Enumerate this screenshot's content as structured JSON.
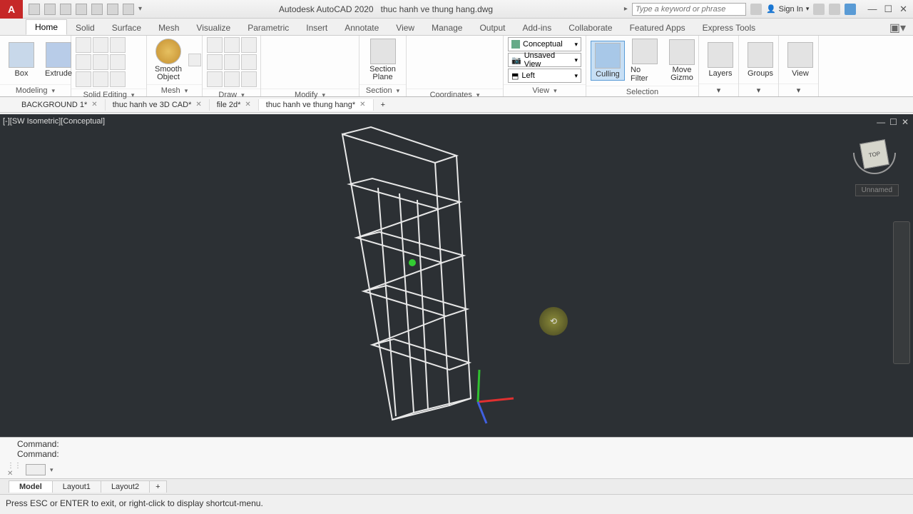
{
  "title": {
    "app": "Autodesk AutoCAD 2020",
    "file": "thuc hanh ve thung hang.dwg"
  },
  "search": {
    "placeholder": "Type a keyword or phrase"
  },
  "signin": {
    "label": "Sign In"
  },
  "ribbon_tabs": [
    "Home",
    "Solid",
    "Surface",
    "Mesh",
    "Visualize",
    "Parametric",
    "Insert",
    "Annotate",
    "View",
    "Manage",
    "Output",
    "Add-ins",
    "Collaborate",
    "Featured Apps",
    "Express Tools"
  ],
  "active_ribbon_tab": "Home",
  "panels": {
    "modeling": {
      "title": "Modeling",
      "box": "Box",
      "extrude": "Extrude"
    },
    "solidediting": {
      "title": "Solid Editing"
    },
    "mesh": {
      "title": "Mesh",
      "smooth": "Smooth Object"
    },
    "draw": {
      "title": "Draw"
    },
    "modify": {
      "title": "Modify"
    },
    "section": {
      "title": "Section",
      "plane": "Section Plane"
    },
    "coordinates": {
      "title": "Coordinates"
    },
    "view": {
      "title": "View",
      "style": "Conceptual",
      "savedview": "Unsaved View",
      "ucs": "Left"
    },
    "selection": {
      "title": "Selection",
      "culling": "Culling",
      "nofilter": "No Filter",
      "gizmo": "Move Gizmo"
    },
    "layers": {
      "title": "Layers"
    },
    "groups": {
      "title": "Groups"
    },
    "viewpanel": {
      "title": "View"
    }
  },
  "file_tabs": [
    {
      "name": "BACKGROUND 1*",
      "active": false
    },
    {
      "name": "thuc hanh ve 3D CAD*",
      "active": false
    },
    {
      "name": "file 2d*",
      "active": false
    },
    {
      "name": "thuc hanh ve thung hang*",
      "active": true
    }
  ],
  "viewport": {
    "label": "[-][SW Isometric][Conceptual]",
    "viewcube_face": "TOP",
    "ucs_name": "Unnamed"
  },
  "command": {
    "hist1": "Command:",
    "hist2": "Command:"
  },
  "bottom_tabs": [
    "Model",
    "Layout1",
    "Layout2"
  ],
  "active_bottom_tab": "Model",
  "status": {
    "text": "Press ESC or ENTER to exit, or right-click to display shortcut-menu."
  },
  "chart_data": null
}
